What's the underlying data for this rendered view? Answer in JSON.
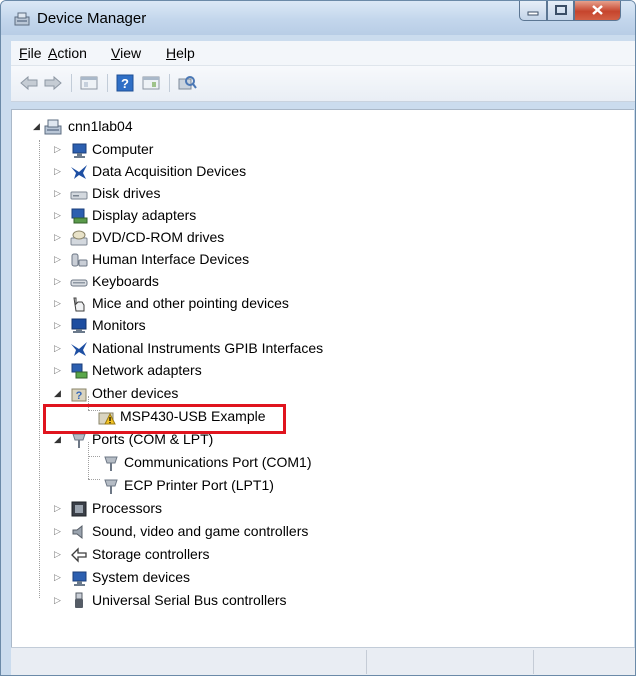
{
  "window": {
    "title": "Device Manager"
  },
  "menu": [
    {
      "mnemonic": "F",
      "rest": "ile"
    },
    {
      "mnemonic": "A",
      "rest": "ction"
    },
    {
      "mnemonic": "V",
      "rest": "iew"
    },
    {
      "mnemonic": "H",
      "rest": "elp"
    }
  ],
  "toolbar": {
    "buttons": [
      "back-arrow-icon",
      "forward-arrow-icon",
      "properties-icon",
      "help-icon",
      "update-driver-icon",
      "scan-hardware-icon"
    ]
  },
  "tree": {
    "root": {
      "label": "cnn1lab04",
      "expanded": true
    },
    "categories": [
      {
        "label": "Computer",
        "icon": "computer-icon",
        "expanded": false
      },
      {
        "label": "Data Acquisition Devices",
        "icon": "ni-eagle-icon",
        "expanded": false
      },
      {
        "label": "Disk drives",
        "icon": "disk-drive-icon",
        "expanded": false
      },
      {
        "label": "Display adapters",
        "icon": "display-adapter-icon",
        "expanded": false
      },
      {
        "label": "DVD/CD-ROM drives",
        "icon": "dvd-drive-icon",
        "expanded": false
      },
      {
        "label": "Human Interface Devices",
        "icon": "hid-icon",
        "expanded": false
      },
      {
        "label": "Keyboards",
        "icon": "keyboard-icon",
        "expanded": false
      },
      {
        "label": "Mice and other pointing devices",
        "icon": "mouse-icon",
        "expanded": false
      },
      {
        "label": "Monitors",
        "icon": "monitor-icon",
        "expanded": false
      },
      {
        "label": "National Instruments GPIB Interfaces",
        "icon": "ni-eagle-icon",
        "expanded": false
      },
      {
        "label": "Network adapters",
        "icon": "network-adapter-icon",
        "expanded": false
      },
      {
        "label": "Other devices",
        "icon": "unknown-device-icon",
        "expanded": true,
        "children": [
          {
            "label": "MSP430-USB Example",
            "icon": "warning-device-icon"
          }
        ]
      },
      {
        "label": "Ports (COM & LPT)",
        "icon": "port-icon",
        "expanded": true,
        "children": [
          {
            "label": "Communications Port (COM1)",
            "icon": "port-icon"
          },
          {
            "label": "ECP Printer Port (LPT1)",
            "icon": "port-icon"
          }
        ]
      },
      {
        "label": "Processors",
        "icon": "processor-icon",
        "expanded": false
      },
      {
        "label": "Sound, video and game controllers",
        "icon": "speaker-icon",
        "expanded": false
      },
      {
        "label": "Storage controllers",
        "icon": "storage-controller-icon",
        "expanded": false
      },
      {
        "label": "System devices",
        "icon": "system-device-icon",
        "expanded": false
      },
      {
        "label": "Universal Serial Bus controllers",
        "icon": "usb-icon",
        "expanded": false
      }
    ]
  },
  "colors": {
    "highlight_box": "#e0141e",
    "close_button": "#c6452d",
    "frame": "#cbdcee"
  }
}
